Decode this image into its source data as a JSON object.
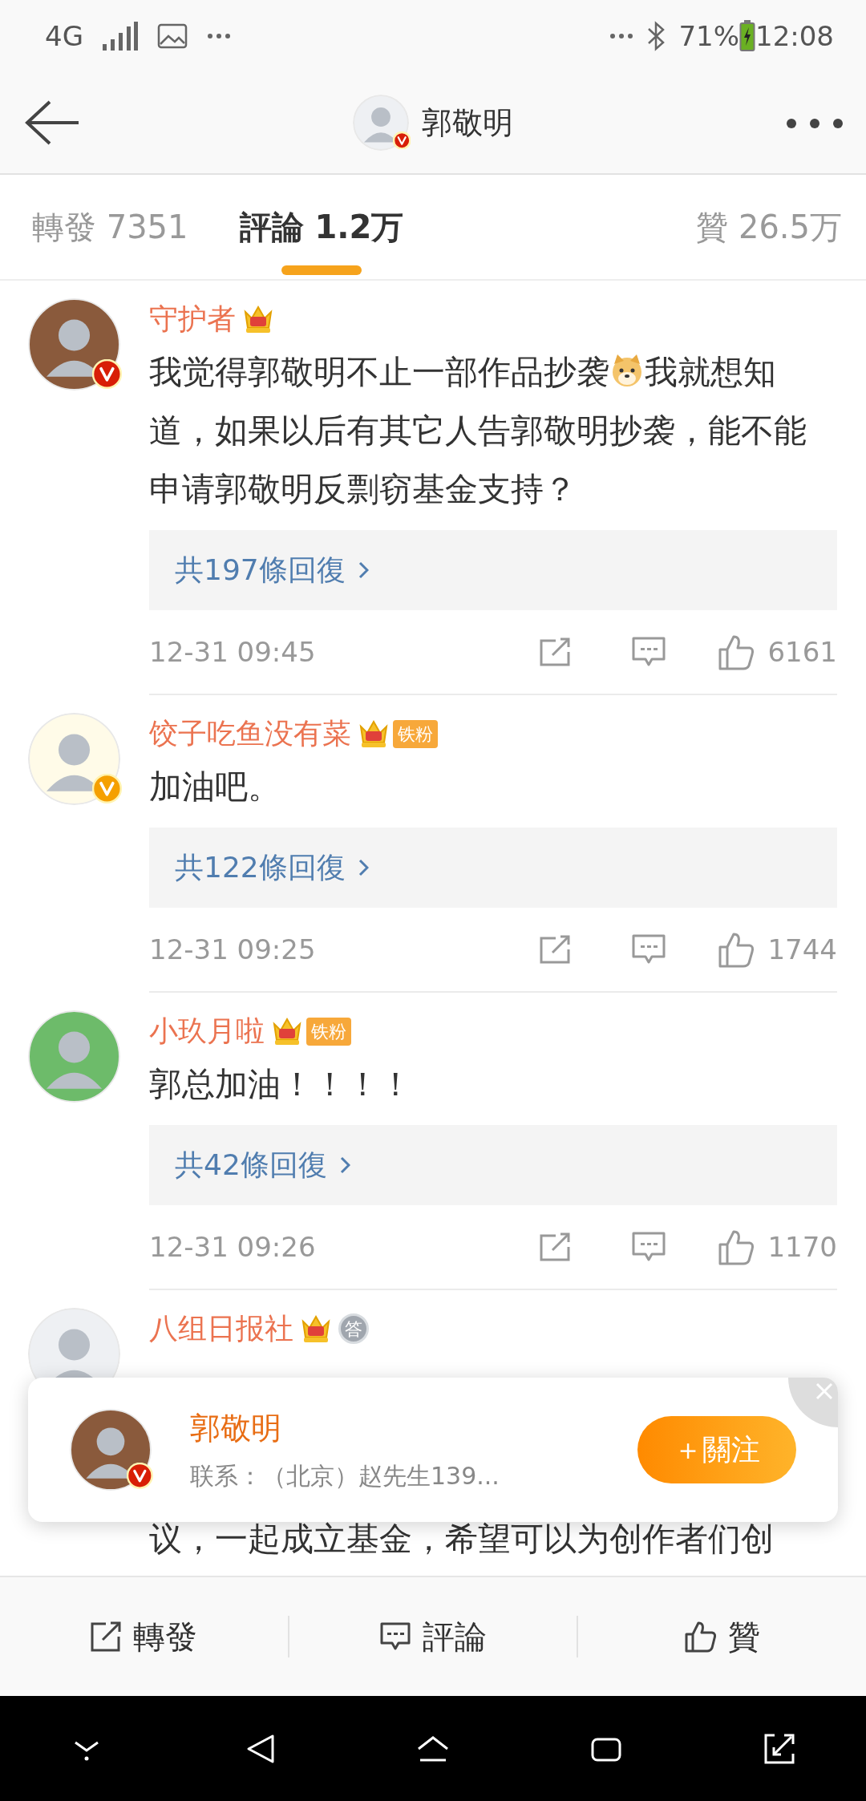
{
  "status_bar": {
    "network": "4G",
    "battery": "71%",
    "time": "12:08"
  },
  "header": {
    "title": "郭敬明",
    "verified": {
      "color": "#d81e06"
    }
  },
  "tabs": [
    {
      "label": "轉發 7351",
      "selected": false
    },
    {
      "label": "評論 1.2万",
      "selected": true
    },
    {
      "label": "贊 26.5万",
      "selected": false
    }
  ],
  "comments": [
    {
      "user": "守护者",
      "verified": {
        "color": "#d81e06"
      },
      "content": [
        {
          "kind": "text",
          "text": "我觉得郭敬明不止一部作品抄袭"
        },
        {
          "kind": "emoji"
        },
        {
          "kind": "text",
          "text": "我就想知"
        },
        {
          "kind": "paragraph",
          "text": "道，如果以后有其它人告郭敬明抄袭，能不能申请郭敬明反剽窃基金支持？"
        }
      ],
      "replies": "共197條回復",
      "time": "12-31 09:45",
      "likes": "6161"
    },
    {
      "user": "饺子吃鱼没有菜",
      "verified": {
        "color": "#f5a000"
      },
      "fan_tag": "铁粉",
      "content": [
        {
          "kind": "paragraph",
          "text": "加油吧。"
        }
      ],
      "replies": "共122條回復",
      "time": "12-31 09:25",
      "likes": "1744"
    },
    {
      "user": "小玖月啦",
      "fan_tag": "铁粉",
      "content": [
        {
          "kind": "paragraph",
          "text": "郭总加油！！！！"
        }
      ],
      "replies": "共42條回復",
      "time": "12-31 09:26",
      "likes": "1170"
    },
    {
      "user": "八组日报社",
      "medal": "答",
      "partly_hidden": true,
      "content": [
        {
          "kind": "paragraph",
          "text": "议，一起成立基金，希望可以为创作者们创"
        }
      ]
    }
  ],
  "popup": {
    "name": "郭敬明",
    "verified": {
      "color": "#d81e06"
    },
    "subtitle": "联系：（北京）赵先生139...",
    "button": "＋關注"
  },
  "action_bar": [
    {
      "kind": "share",
      "label": "轉發"
    },
    {
      "kind": "comment",
      "label": "評論"
    },
    {
      "kind": "like",
      "label": "贊"
    }
  ]
}
